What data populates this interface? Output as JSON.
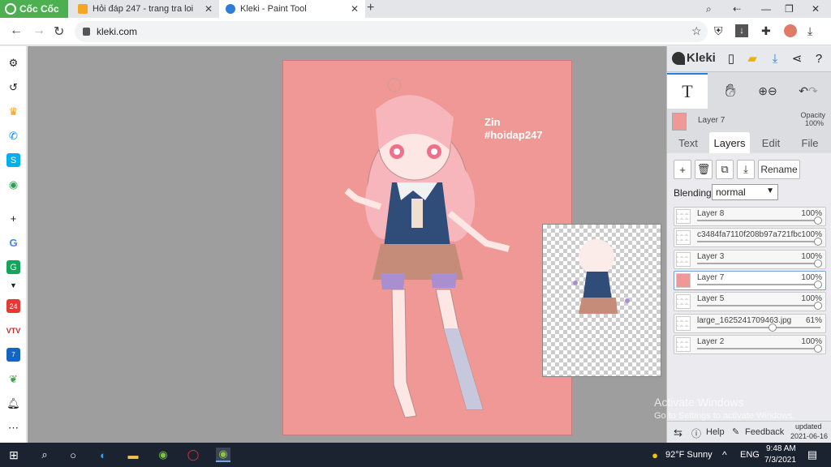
{
  "browser": {
    "brand": "Cốc Cốc",
    "tabs": [
      {
        "title": "Hỏi đáp 247 - trang tra loi"
      },
      {
        "title": "Kleki - Paint Tool"
      }
    ],
    "url": "kleki.com"
  },
  "artwork": {
    "signature": "Zin",
    "hashtag": "#hoidap247"
  },
  "kleki": {
    "logo": "Kleki",
    "current_layer": "Layer 7",
    "opacity_label": "Opacity",
    "opacity_value": "100%",
    "tabs": [
      "Text",
      "Layers",
      "Edit",
      "File"
    ],
    "active_tab": "Layers",
    "rename_label": "Rename",
    "blending_label": "Blending",
    "blending_value": "normal",
    "layers": [
      {
        "name": "Layer 8",
        "opacity": "100%",
        "fraction": 1.0,
        "selected": false
      },
      {
        "name": "c3484fa7110f208b97a721fbc",
        "opacity": "100%",
        "fraction": 1.0,
        "selected": false
      },
      {
        "name": "Layer 3",
        "opacity": "100%",
        "fraction": 1.0,
        "selected": false
      },
      {
        "name": "Layer 7",
        "opacity": "100%",
        "fraction": 1.0,
        "selected": true
      },
      {
        "name": "Layer 5",
        "opacity": "100%",
        "fraction": 1.0,
        "selected": false
      },
      {
        "name": "large_1625241709463.jpg",
        "opacity": "61%",
        "fraction": 0.61,
        "selected": false
      },
      {
        "name": "Layer 2",
        "opacity": "100%",
        "fraction": 1.0,
        "selected": false
      }
    ],
    "help_label": "Help",
    "feedback_label": "Feedback",
    "updated_label": "updated",
    "updated_date": "2021-06-16"
  },
  "os": {
    "watermark_title": "Activate Windows",
    "watermark_sub": "Go to Settings to activate Windows.",
    "weather": "92°F  Sunny",
    "lang": "ENG",
    "time": "9:48 AM",
    "date": "7/3/2021"
  },
  "colors": {
    "brand_green": "#4caf50",
    "canvas_pink": "#f09895",
    "accent_blue": "#2e7dd6"
  }
}
